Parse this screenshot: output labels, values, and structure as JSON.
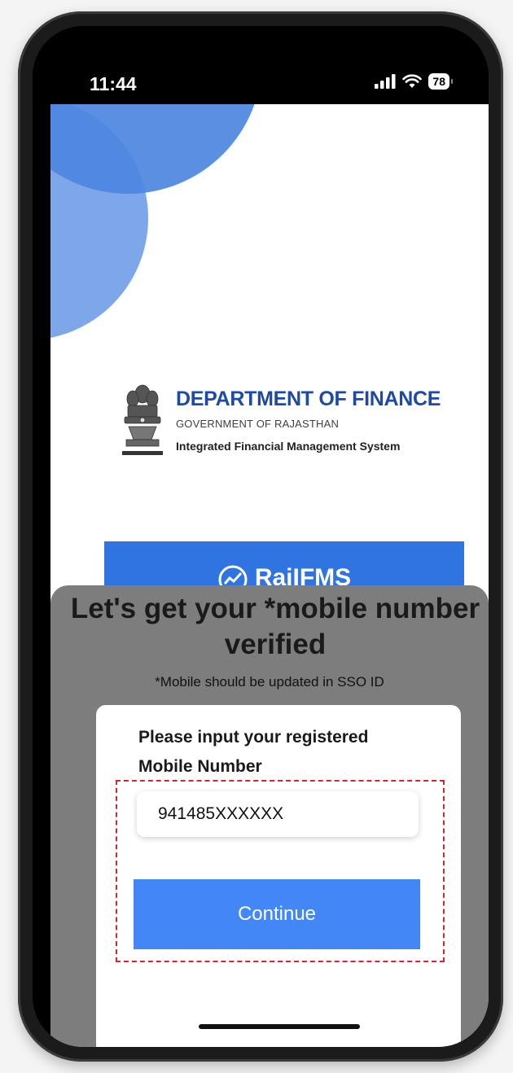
{
  "status_bar": {
    "time": "11:44",
    "signal_icon": "cellular-signal-icon",
    "wifi_icon": "wifi-icon",
    "battery": "78"
  },
  "branding": {
    "emblem_icon": "state-emblem-icon",
    "title": "DEPARTMENT OF FINANCE",
    "subtitle": "GOVERNMENT OF RAJASTHAN",
    "system": "Integrated Financial Management System",
    "banner_logo_icon": "raj-ifms-logo-icon",
    "banner_text": "RajIFMS"
  },
  "verification_sheet": {
    "title": "Let's get your *mobile number verified",
    "subtitle": "*Mobile should be updated in SSO ID",
    "input_label": "Please input your registered Mobile Number",
    "mobile_value": "941485XXXXXX",
    "continue_label": "Continue"
  },
  "colors": {
    "brand_blue": "#1d49a8",
    "banner_blue": "#2f74e0",
    "button_blue": "#4287f5",
    "overlay_gray": "#7d7d7d",
    "highlight_red": "#d7262c"
  }
}
